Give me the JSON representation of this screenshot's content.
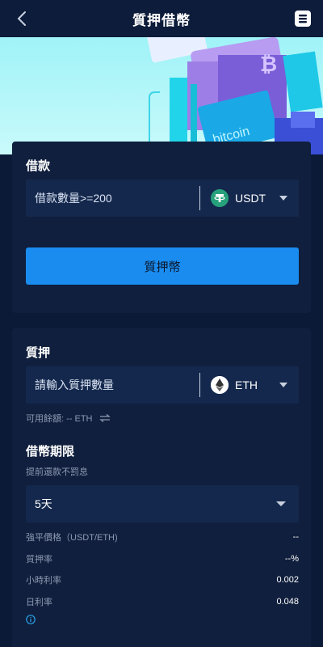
{
  "header": {
    "title": "質押借幣"
  },
  "loan": {
    "section_title": "借款",
    "placeholder": "借款數量>=200",
    "coin": "USDT",
    "coin_color": "#26a17b",
    "button_label": "質押幣"
  },
  "pledge": {
    "section_title": "質押",
    "placeholder": "請輸入質押數量",
    "coin": "ETH",
    "available_label": "可用餘額: -- ETH",
    "term_title": "借幣期限",
    "term_subtitle": "提前還款不罰息",
    "term_selected": "5天",
    "rows": [
      {
        "label": "強平價格（USDT/ETH)",
        "value": "--"
      },
      {
        "label": "質押率",
        "value": "--%"
      },
      {
        "label": "小時利率",
        "value": "0.002"
      },
      {
        "label": "日利率",
        "value": "0.048"
      }
    ]
  },
  "colors": {
    "accent": "#1a8cf0",
    "background": "#0b1a36",
    "card": "#101f3d",
    "field": "#14284d",
    "info": "#2aa3e8"
  }
}
